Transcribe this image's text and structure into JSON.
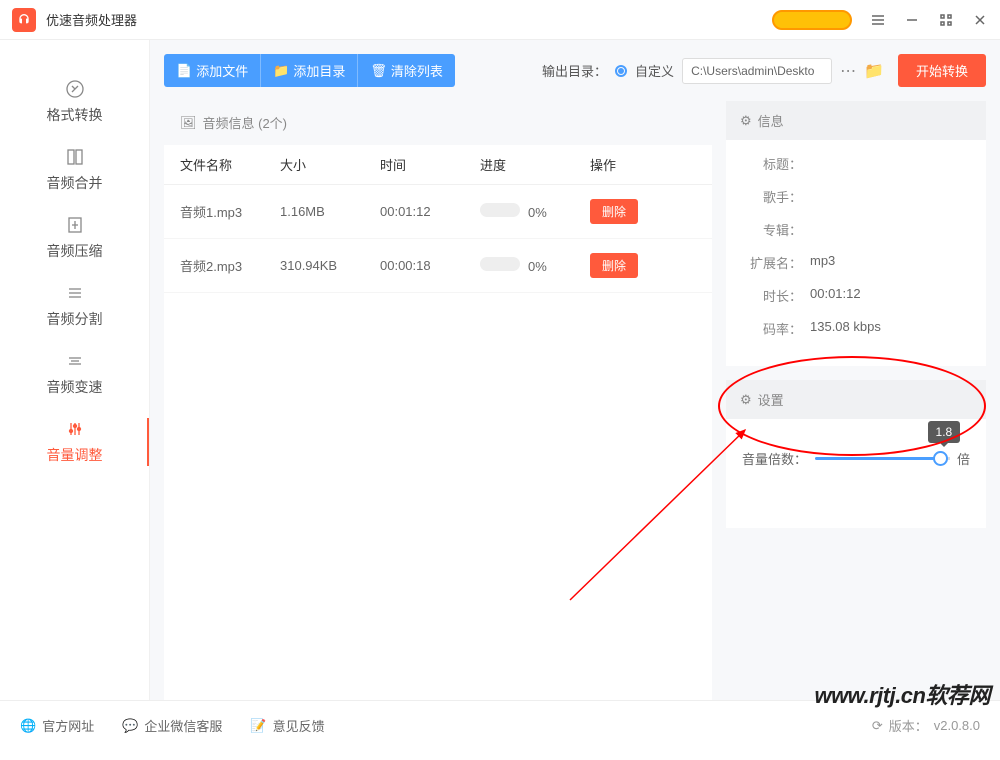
{
  "app": {
    "title": "优速音频处理器"
  },
  "sidebar": {
    "items": [
      {
        "label": "格式转换"
      },
      {
        "label": "音频合并"
      },
      {
        "label": "音频压缩"
      },
      {
        "label": "音频分割"
      },
      {
        "label": "音频变速"
      },
      {
        "label": "音量调整"
      }
    ]
  },
  "toolbar": {
    "add_file": "添加文件",
    "add_dir": "添加目录",
    "clear": "清除列表",
    "output_label": "输出目录：",
    "custom": "自定义",
    "path": "C:\\Users\\admin\\Deskto",
    "start": "开始转换"
  },
  "files_panel": {
    "title": "音频信息  (2个)",
    "columns": {
      "name": "文件名称",
      "size": "大小",
      "time": "时间",
      "progress": "进度",
      "op": "操作"
    },
    "rows": [
      {
        "name": "音频1.mp3",
        "size": "1.16MB",
        "time": "00:01:12",
        "progress": "0%",
        "op": "删除"
      },
      {
        "name": "音频2.mp3",
        "size": "310.94KB",
        "time": "00:00:18",
        "progress": "0%",
        "op": "删除"
      }
    ]
  },
  "info": {
    "title": "信息",
    "labels": {
      "title_l": "标题：",
      "artist": "歌手：",
      "album": "专辑：",
      "ext": "扩展名：",
      "duration": "时长：",
      "bitrate": "码率："
    },
    "values": {
      "ext": "mp3",
      "duration": "00:01:12",
      "bitrate": "135.08 kbps"
    }
  },
  "settings": {
    "title": "设置",
    "volume_label": "音量倍数：",
    "volume_value": "1.8",
    "unit": "倍"
  },
  "footer": {
    "site": "官方网址",
    "support": "企业微信客服",
    "feedback": "意见反馈",
    "version_label": "版本：",
    "version": "v2.0.8.0"
  },
  "watermark": "www.rjtj.cn软荐网"
}
